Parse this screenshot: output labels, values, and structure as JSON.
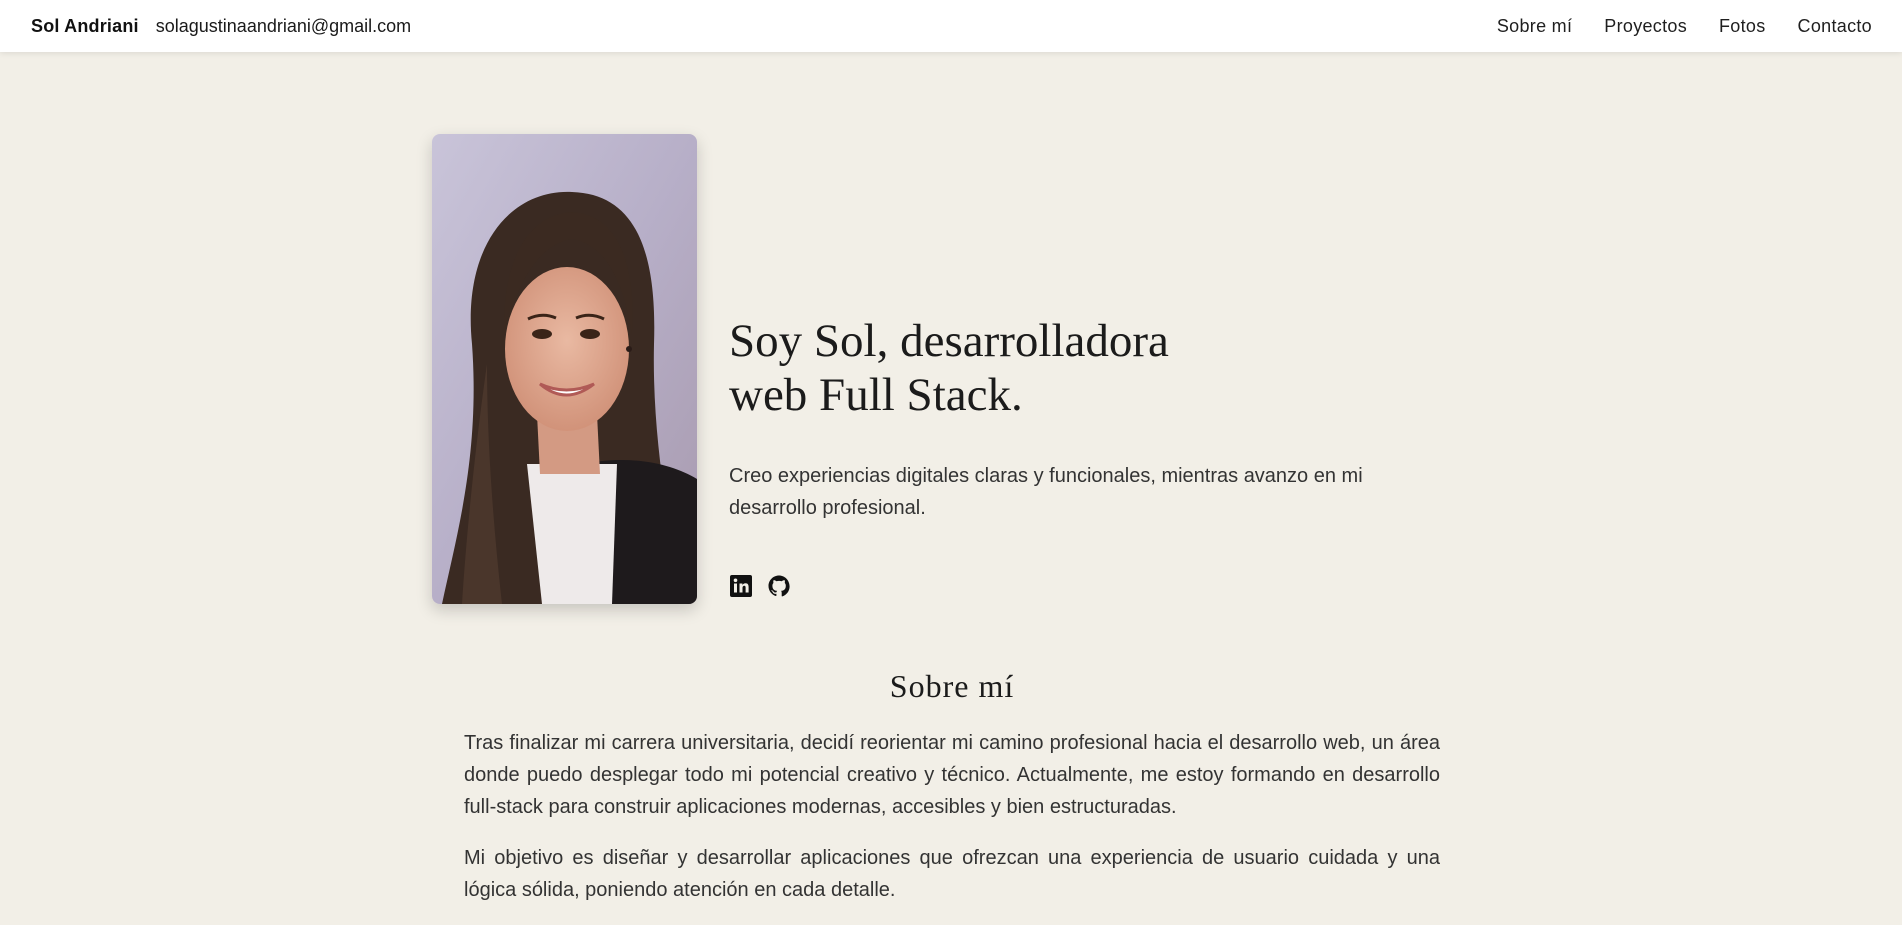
{
  "header": {
    "brand_name": "Sol Andriani",
    "email": "solagustinaandriani@gmail.com",
    "nav": [
      {
        "label": "Sobre mí"
      },
      {
        "label": "Proyectos"
      },
      {
        "label": "Fotos"
      },
      {
        "label": "Contacto"
      }
    ]
  },
  "hero": {
    "title_line1": "Soy Sol, desarrolladora",
    "title_line2": "web Full Stack.",
    "subtitle": "Creo experiencias digitales claras y funcionales, mientras avanzo en mi desarrollo profesional.",
    "socials": [
      {
        "icon": "linkedin-icon"
      },
      {
        "icon": "github-icon"
      }
    ]
  },
  "about": {
    "title": "Sobre mí",
    "paragraphs": [
      "Tras finalizar mi carrera universitaria, decidí reorientar mi camino profesional hacia el desarrollo web, un área donde puedo desplegar todo mi potencial creativo y técnico. Actualmente, me estoy formando en desarrollo full-stack para construir aplicaciones modernas, accesibles y bien estructuradas.",
      "Mi objetivo es diseñar y desarrollar aplicaciones que ofrezcan una experiencia de usuario cuidada y una lógica sólida, poniendo atención en cada detalle."
    ]
  },
  "colors": {
    "background": "#f2efe7",
    "header": "#ffffff",
    "text": "#2b2b2b"
  }
}
